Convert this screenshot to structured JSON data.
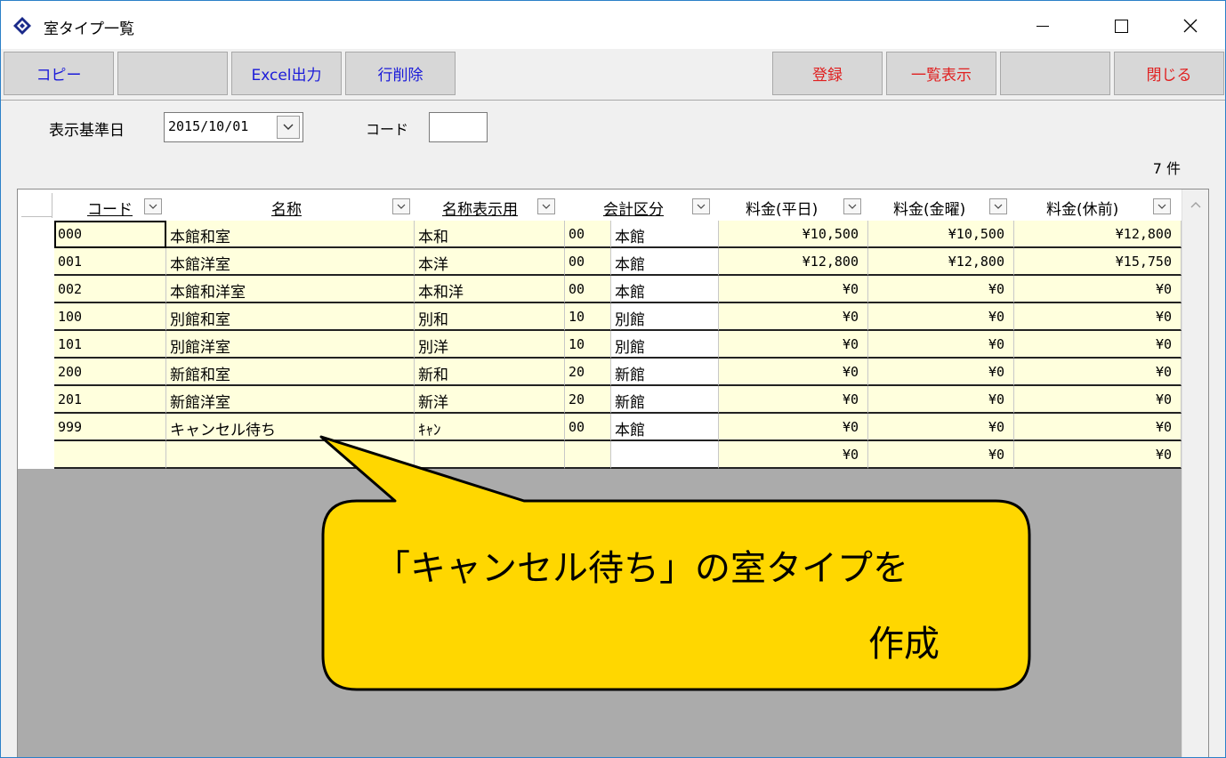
{
  "window": {
    "title": "室タイプ一覧"
  },
  "toolbar": {
    "copy": "コピー",
    "blank1": "",
    "excel": "Excel出力",
    "delete_row": "行削除",
    "register": "登録",
    "list": "一覧表示",
    "blank2": "",
    "close": "閉じる"
  },
  "filter": {
    "date_label": "表示基準日",
    "date_value": "2015/10/01",
    "code_label": "コード",
    "code_value": "",
    "count": "7 件"
  },
  "grid": {
    "columns": [
      "コード",
      "名称",
      "名称表示用",
      "会計区分",
      "料金(平日)",
      "料金(金曜)",
      "料金(休前)"
    ],
    "rows": [
      {
        "code": "000",
        "name": "本館和室",
        "short": "本和",
        "acct_code": "00",
        "acct_name": "本館",
        "weekday": "¥10,500",
        "friday": "¥10,500",
        "holiday": "¥12,800"
      },
      {
        "code": "001",
        "name": "本館洋室",
        "short": "本洋",
        "acct_code": "00",
        "acct_name": "本館",
        "weekday": "¥12,800",
        "friday": "¥12,800",
        "holiday": "¥15,750"
      },
      {
        "code": "002",
        "name": "本館和洋室",
        "short": "本和洋",
        "acct_code": "00",
        "acct_name": "本館",
        "weekday": "¥0",
        "friday": "¥0",
        "holiday": "¥0"
      },
      {
        "code": "100",
        "name": "別館和室",
        "short": "別和",
        "acct_code": "10",
        "acct_name": "別館",
        "weekday": "¥0",
        "friday": "¥0",
        "holiday": "¥0"
      },
      {
        "code": "101",
        "name": "別館洋室",
        "short": "別洋",
        "acct_code": "10",
        "acct_name": "別館",
        "weekday": "¥0",
        "friday": "¥0",
        "holiday": "¥0"
      },
      {
        "code": "200",
        "name": "新館和室",
        "short": "新和",
        "acct_code": "20",
        "acct_name": "新館",
        "weekday": "¥0",
        "friday": "¥0",
        "holiday": "¥0"
      },
      {
        "code": "201",
        "name": "新館洋室",
        "short": "新洋",
        "acct_code": "20",
        "acct_name": "新館",
        "weekday": "¥0",
        "friday": "¥0",
        "holiday": "¥0"
      },
      {
        "code": "999",
        "name": "キャンセル待ち",
        "short": "ｷｬﾝ",
        "acct_code": "00",
        "acct_name": "本館",
        "weekday": "¥0",
        "friday": "¥0",
        "holiday": "¥0"
      },
      {
        "code": "",
        "name": "",
        "short": "",
        "acct_code": "",
        "acct_name": "",
        "weekday": "¥0",
        "friday": "¥0",
        "holiday": "¥0"
      }
    ]
  },
  "callout": {
    "line1": "「キャンセル待ち」の室タイプを",
    "line2": "作成",
    "fill": "#ffd700"
  },
  "colors": {
    "accent_blue": "#1b1bd9",
    "accent_red": "#e02020",
    "row_fill": "#ffffdd",
    "empty_area": "#ababab"
  }
}
